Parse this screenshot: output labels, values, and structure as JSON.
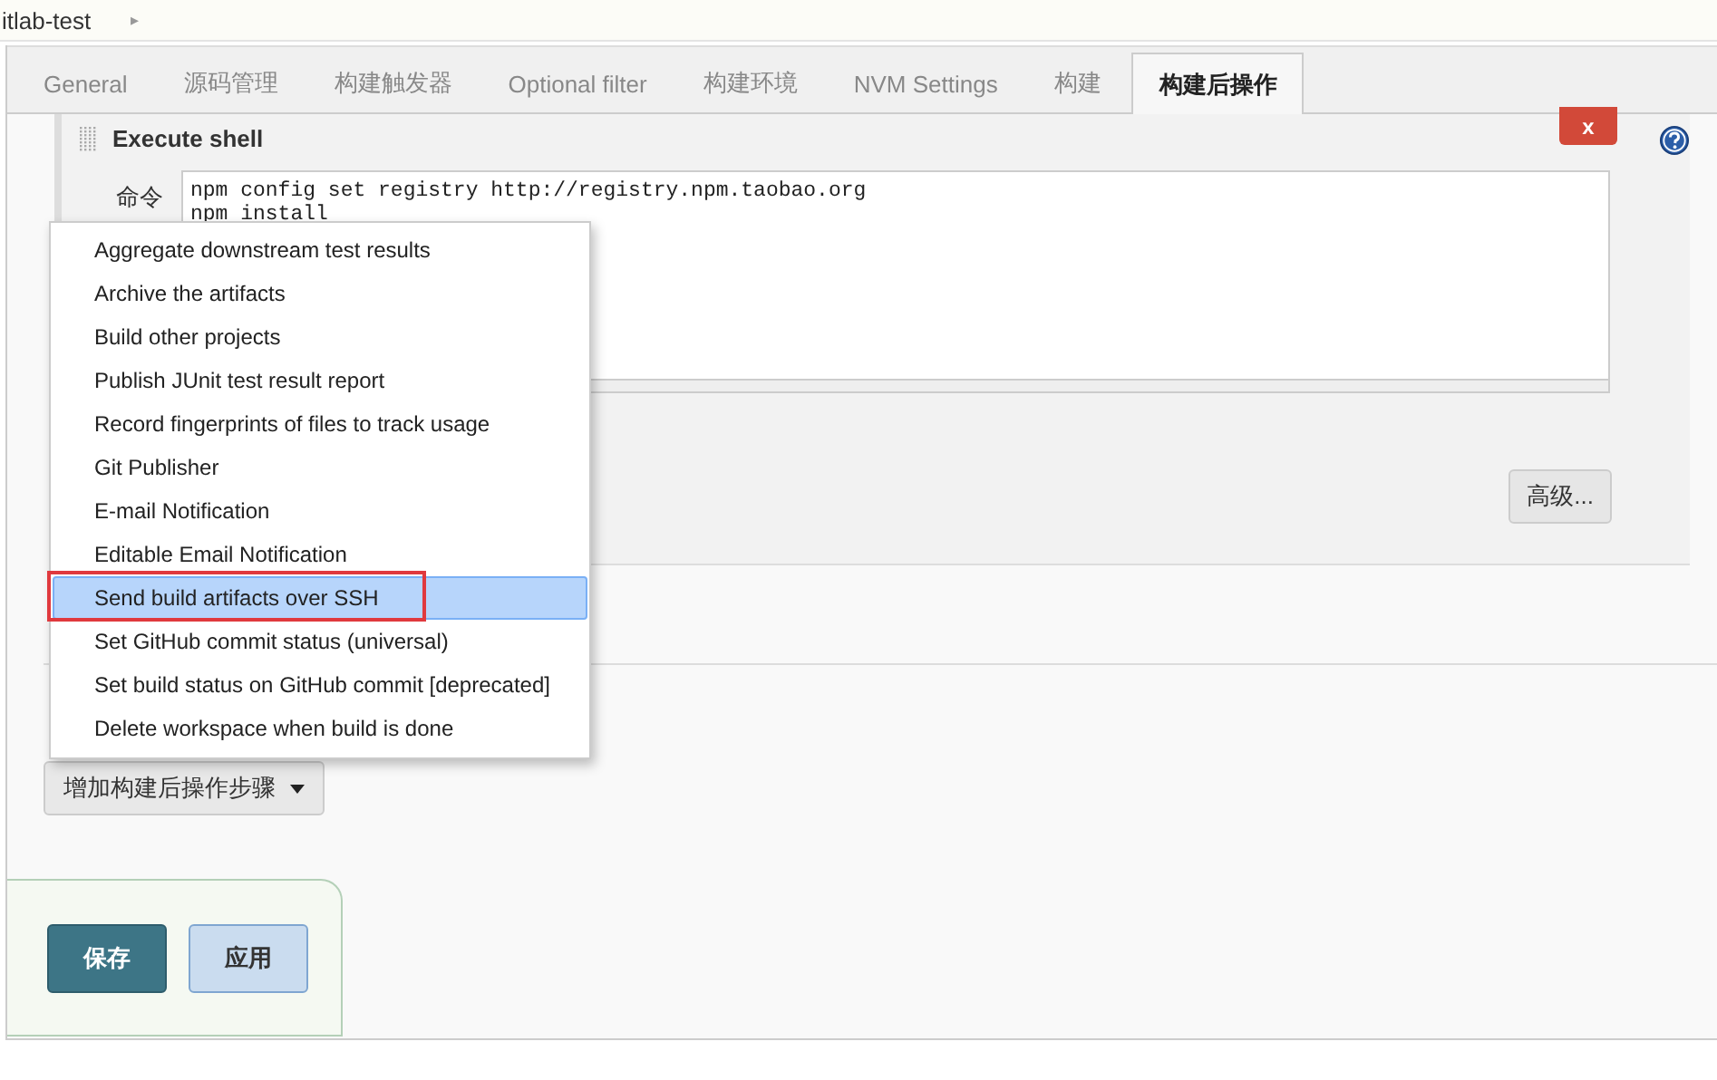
{
  "breadcrumb": {
    "item": "itlab-test",
    "separator": "▸"
  },
  "tabs": [
    {
      "label": "General",
      "selected": false
    },
    {
      "label": "源码管理",
      "selected": false
    },
    {
      "label": "构建触发器",
      "selected": false
    },
    {
      "label": "Optional filter",
      "selected": false
    },
    {
      "label": "构建环境",
      "selected": false
    },
    {
      "label": "NVM Settings",
      "selected": false
    },
    {
      "label": "构建",
      "selected": false
    },
    {
      "label": "构建后操作",
      "selected": true
    }
  ],
  "build_step": {
    "title": "Execute shell",
    "delete_button": "x",
    "command_label": "命令",
    "command": "npm config set registry http://registry.npm.taobao.org\nnpm install",
    "advanced_button": "高级..."
  },
  "dropdown_menu": [
    {
      "label": "Aggregate downstream test results",
      "selected": false
    },
    {
      "label": "Archive the artifacts",
      "selected": false
    },
    {
      "label": "Build other projects",
      "selected": false
    },
    {
      "label": "Publish JUnit test result report",
      "selected": false
    },
    {
      "label": "Record fingerprints of files to track usage",
      "selected": false
    },
    {
      "label": "Git Publisher",
      "selected": false
    },
    {
      "label": "E-mail Notification",
      "selected": false
    },
    {
      "label": "Editable Email Notification",
      "selected": false
    },
    {
      "label": "Send build artifacts over SSH",
      "selected": true
    },
    {
      "label": "Set GitHub commit status (universal)",
      "selected": false
    },
    {
      "label": "Set build status on GitHub commit [deprecated]",
      "selected": false
    },
    {
      "label": "Delete workspace when build is done",
      "selected": false
    }
  ],
  "add_step_button": "增加构建后操作步骤",
  "buttons": [
    {
      "label": "保存",
      "kind": "primary"
    },
    {
      "label": "应用",
      "kind": "secondary"
    }
  ]
}
